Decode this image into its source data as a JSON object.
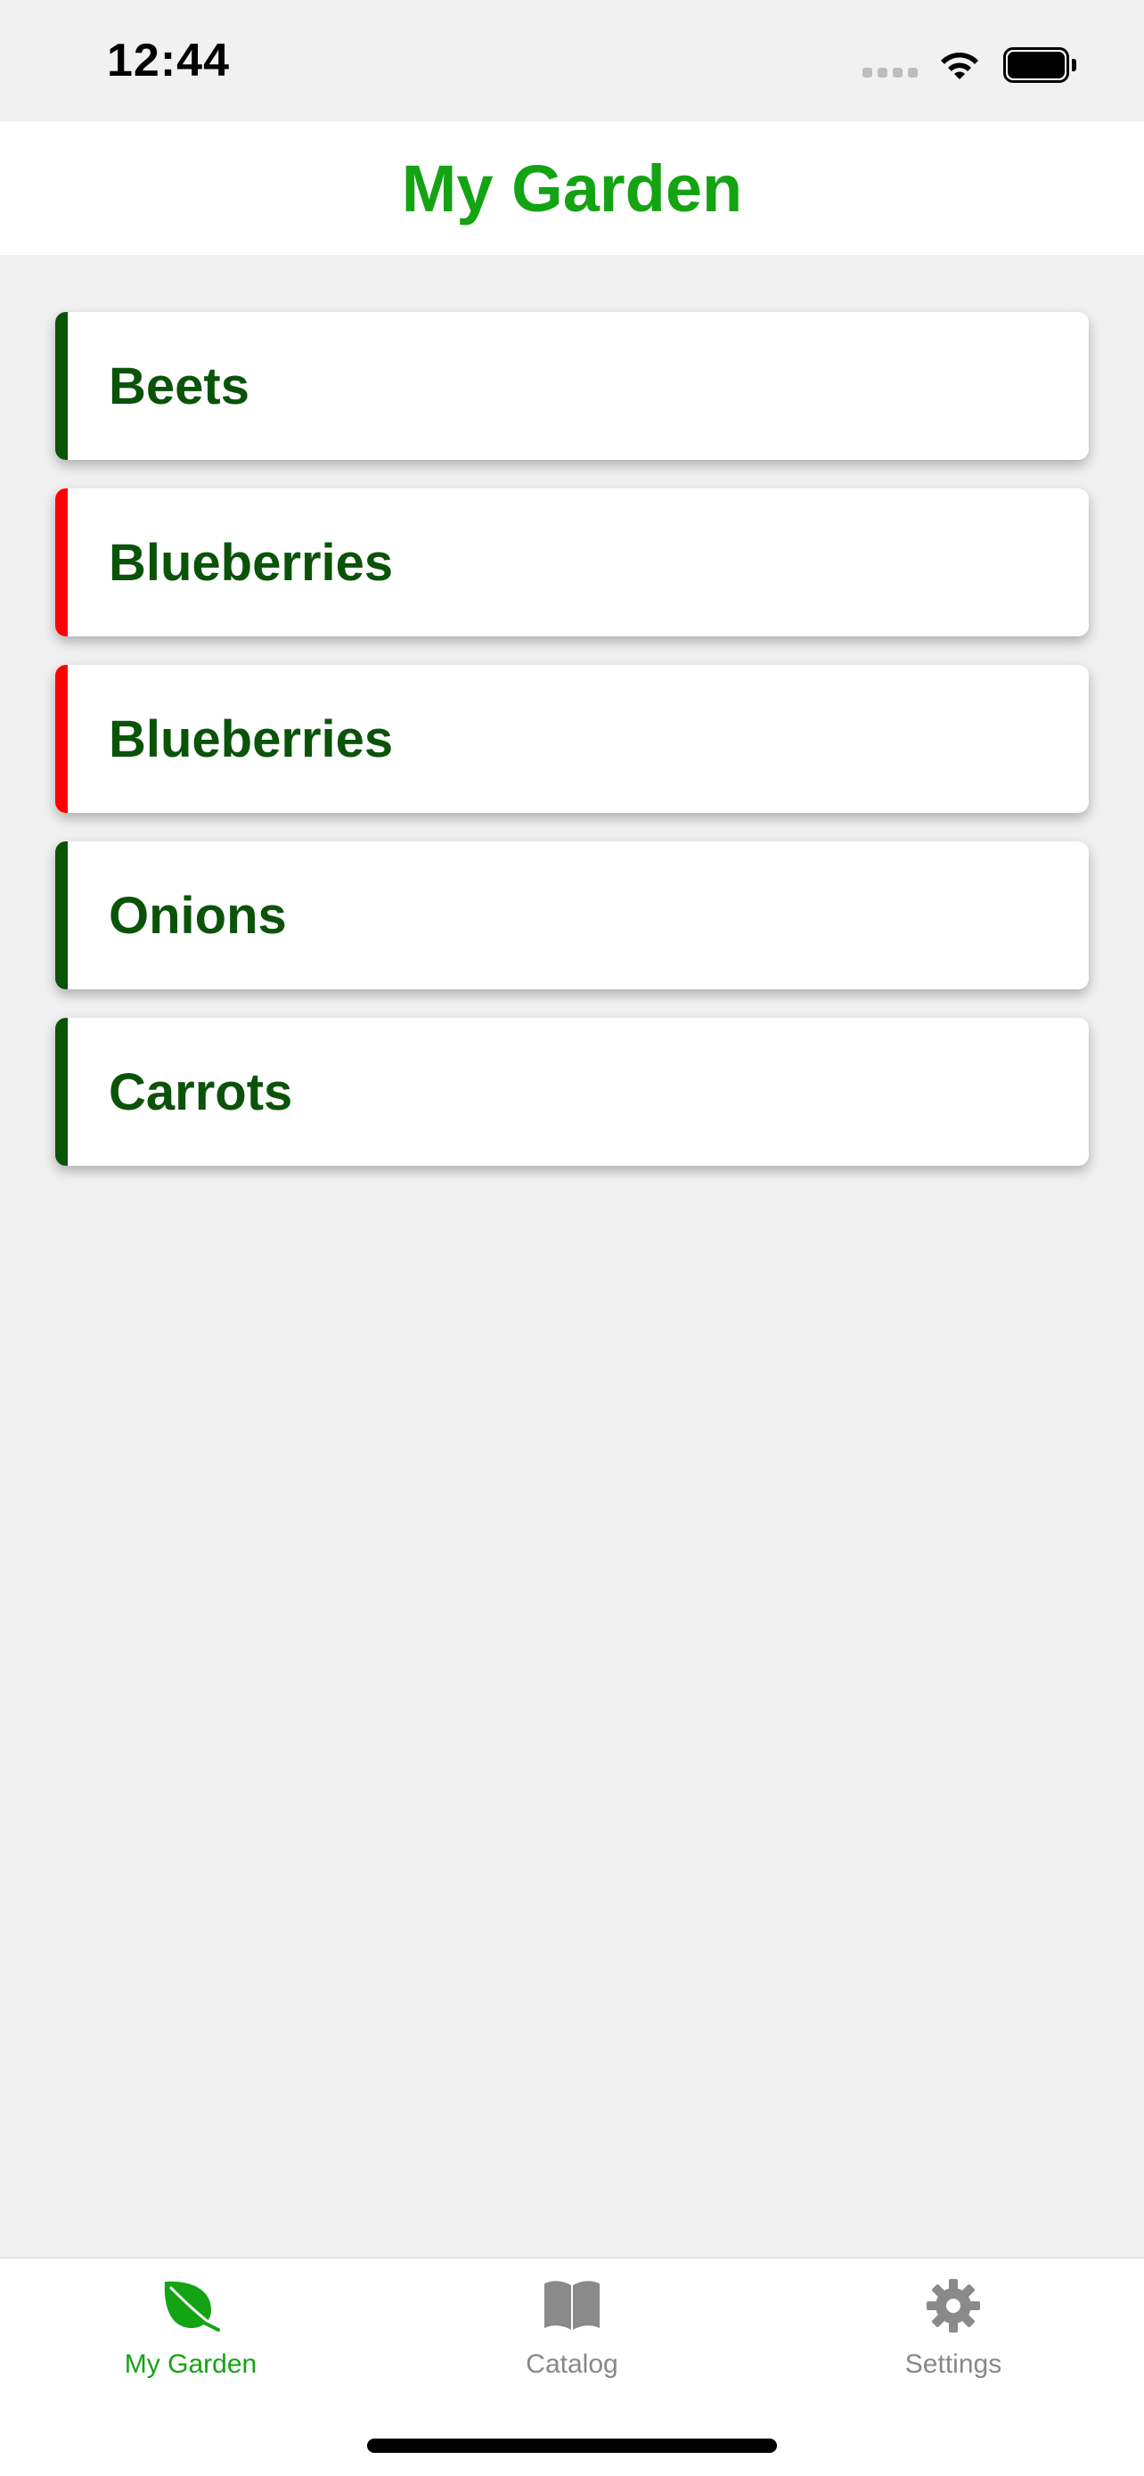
{
  "status_bar": {
    "time": "12:44"
  },
  "header": {
    "title": "My Garden"
  },
  "plants": [
    {
      "name": "Beets",
      "accent_color": "#0a5309"
    },
    {
      "name": "Blueberries",
      "accent_color": "#ff0000"
    },
    {
      "name": "Blueberries",
      "accent_color": "#ff0000"
    },
    {
      "name": "Onions",
      "accent_color": "#0a5309"
    },
    {
      "name": "Carrots",
      "accent_color": "#0a5309"
    }
  ],
  "tab_bar": {
    "tabs": [
      {
        "label": "My Garden",
        "icon": "leaf-icon",
        "active": true
      },
      {
        "label": "Catalog",
        "icon": "book-icon",
        "active": false
      },
      {
        "label": "Settings",
        "icon": "gear-icon",
        "active": false
      }
    ]
  },
  "colors": {
    "brand_green": "#14a313",
    "dark_green": "#0a5309",
    "alert_red": "#ff0000",
    "inactive_gray": "#888888"
  }
}
